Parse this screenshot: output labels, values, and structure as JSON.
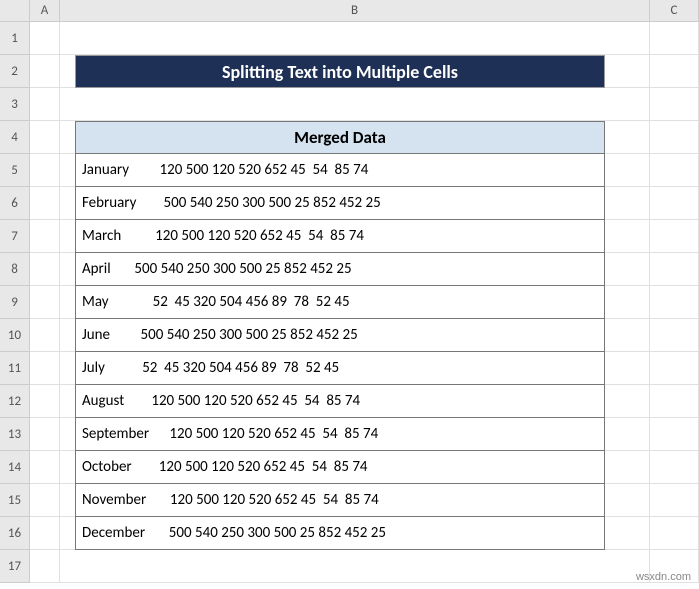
{
  "columns": [
    "A",
    "B",
    "C"
  ],
  "rows": [
    "1",
    "2",
    "3",
    "4",
    "5",
    "6",
    "7",
    "8",
    "9",
    "10",
    "11",
    "12",
    "13",
    "14",
    "15",
    "16",
    "17"
  ],
  "title": "Splitting Text into Multiple Cells",
  "table_header": "Merged Data",
  "data": [
    "January         120 500 120 520 652 45  54  85 74",
    "February        500 540 250 300 500 25 852 452 25",
    "March          120 500 120 520 652 45  54  85 74",
    "April       500 540 250 300 500 25 852 452 25",
    "May             52  45 320 504 456 89  78  52 45",
    "June         500 540 250 300 500 25 852 452 25",
    "July           52  45 320 504 456 89  78  52 45",
    "August        120 500 120 520 652 45  54  85 74",
    "September      120 500 120 520 652 45  54  85 74",
    "October        120 500 120 520 652 45  54  85 74",
    "November       120 500 120 520 652 45  54  85 74",
    "December       500 540 250 300 500 25 852 452 25"
  ],
  "watermark": "wsxdn.com",
  "chart_data": {
    "type": "table",
    "title": "Splitting Text into Multiple Cells",
    "header": "Merged Data",
    "rows": [
      {
        "month": "January",
        "values": [
          120,
          500,
          120,
          520,
          652,
          45,
          54,
          85,
          74
        ]
      },
      {
        "month": "February",
        "values": [
          500,
          540,
          250,
          300,
          500,
          25,
          852,
          452,
          25
        ]
      },
      {
        "month": "March",
        "values": [
          120,
          500,
          120,
          520,
          652,
          45,
          54,
          85,
          74
        ]
      },
      {
        "month": "April",
        "values": [
          500,
          540,
          250,
          300,
          500,
          25,
          852,
          452,
          25
        ]
      },
      {
        "month": "May",
        "values": [
          52,
          45,
          320,
          504,
          456,
          89,
          78,
          52,
          45
        ]
      },
      {
        "month": "June",
        "values": [
          500,
          540,
          250,
          300,
          500,
          25,
          852,
          452,
          25
        ]
      },
      {
        "month": "July",
        "values": [
          52,
          45,
          320,
          504,
          456,
          89,
          78,
          52,
          45
        ]
      },
      {
        "month": "August",
        "values": [
          120,
          500,
          120,
          520,
          652,
          45,
          54,
          85,
          74
        ]
      },
      {
        "month": "September",
        "values": [
          120,
          500,
          120,
          520,
          652,
          45,
          54,
          85,
          74
        ]
      },
      {
        "month": "October",
        "values": [
          120,
          500,
          120,
          520,
          652,
          45,
          54,
          85,
          74
        ]
      },
      {
        "month": "November",
        "values": [
          120,
          500,
          120,
          520,
          652,
          45,
          54,
          85,
          74
        ]
      },
      {
        "month": "December",
        "values": [
          500,
          540,
          250,
          300,
          500,
          25,
          852,
          452,
          25
        ]
      }
    ]
  }
}
